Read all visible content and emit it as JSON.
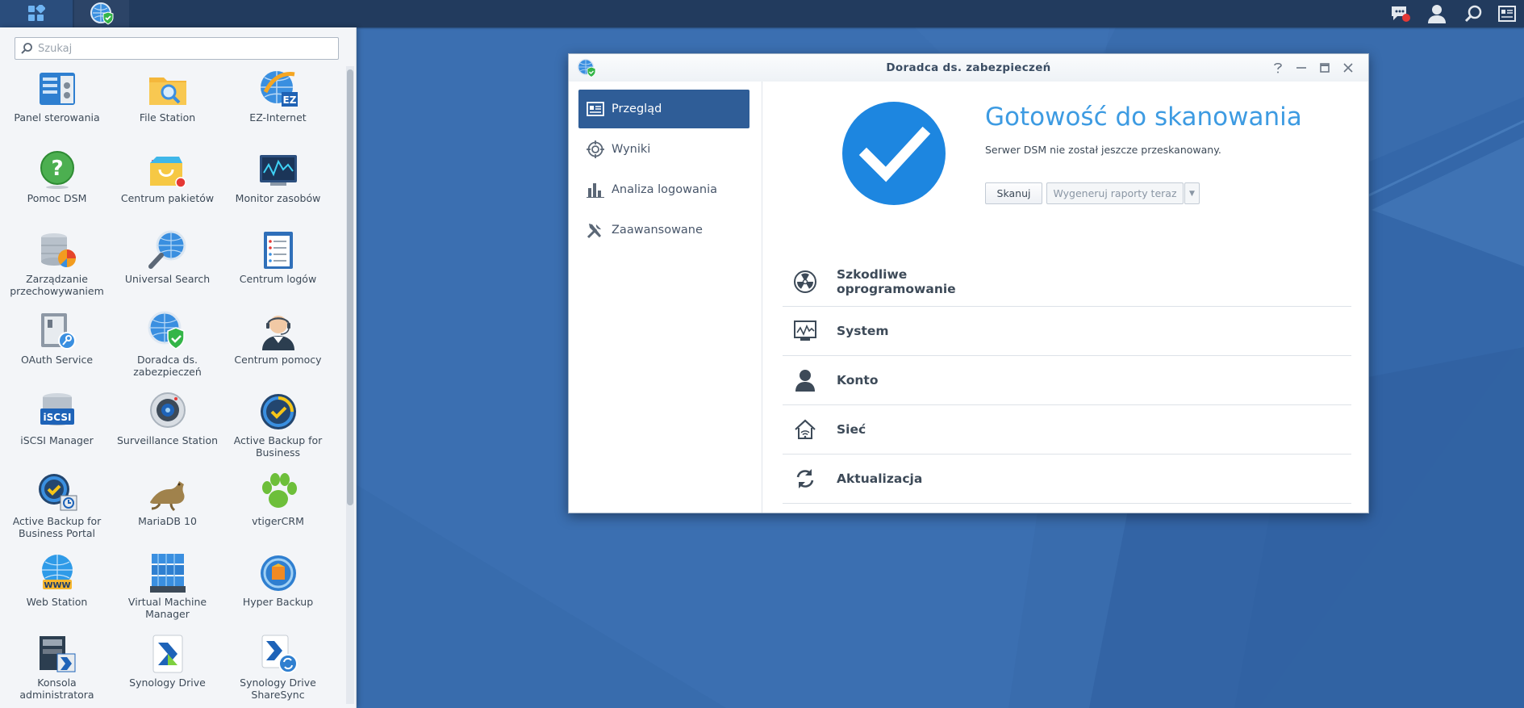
{
  "taskbar": {
    "main_menu_icon": "grid-icon",
    "active_app_icon": "security-advisor-icon",
    "right_icons": [
      "notification-icon",
      "user-icon",
      "search-icon",
      "widgets-icon"
    ]
  },
  "start_menu": {
    "search_placeholder": "Szukaj",
    "apps": [
      {
        "label": "Panel sterowania",
        "icon": "control-panel-icon"
      },
      {
        "label": "File Station",
        "icon": "file-station-icon"
      },
      {
        "label": "EZ-Internet",
        "icon": "ez-internet-icon"
      },
      {
        "label": "Pomoc DSM",
        "icon": "help-icon"
      },
      {
        "label": "Centrum pakietów",
        "icon": "package-center-icon"
      },
      {
        "label": "Monitor zasobów",
        "icon": "resource-monitor-icon"
      },
      {
        "label": "Zarządzanie przechowywaniem",
        "icon": "storage-manager-icon"
      },
      {
        "label": "Universal Search",
        "icon": "universal-search-icon"
      },
      {
        "label": "Centrum logów",
        "icon": "log-center-icon"
      },
      {
        "label": "OAuth Service",
        "icon": "oauth-service-icon"
      },
      {
        "label": "Doradca ds. zabezpieczeń",
        "icon": "security-advisor-icon"
      },
      {
        "label": "Centrum pomocy",
        "icon": "support-center-icon"
      },
      {
        "label": "iSCSI Manager",
        "icon": "iscsi-manager-icon"
      },
      {
        "label": "Surveillance Station",
        "icon": "surveillance-station-icon"
      },
      {
        "label": "Active Backup for Business",
        "icon": "active-backup-icon"
      },
      {
        "label": "Active Backup for Business Portal",
        "icon": "active-backup-portal-icon"
      },
      {
        "label": "MariaDB 10",
        "icon": "mariadb-icon"
      },
      {
        "label": "vtigerCRM",
        "icon": "vtigercrm-icon"
      },
      {
        "label": "Web Station",
        "icon": "web-station-icon"
      },
      {
        "label": "Virtual Machine Manager",
        "icon": "virtual-machine-manager-icon"
      },
      {
        "label": "Hyper Backup",
        "icon": "hyper-backup-icon"
      },
      {
        "label": "Konsola administratora",
        "icon": "admin-console-icon"
      },
      {
        "label": "Synology Drive",
        "icon": "synology-drive-icon"
      },
      {
        "label": "Synology Drive ShareSync",
        "icon": "sharesync-icon"
      }
    ]
  },
  "window": {
    "title": "Doradca ds. zabezpieczeń",
    "controls": [
      "help-icon",
      "minimize-icon",
      "maximize-icon",
      "close-icon"
    ],
    "nav": [
      {
        "label": "Przegląd",
        "icon": "overview-icon",
        "active": true
      },
      {
        "label": "Wyniki",
        "icon": "results-icon",
        "active": false
      },
      {
        "label": "Analiza logowania",
        "icon": "bar-chart-icon",
        "active": false
      },
      {
        "label": "Zaawansowane",
        "icon": "tools-icon",
        "active": false
      }
    ],
    "status": {
      "headline": "Gotowość do skanowania",
      "description": "Serwer DSM nie został jeszcze przeskanowany.",
      "scan_button": "Skanuj",
      "report_button": "Wygeneruj raporty teraz",
      "report_enabled": false
    },
    "categories": [
      {
        "label": "Szkodliwe oprogramowanie",
        "icon": "radiation-icon"
      },
      {
        "label": "System",
        "icon": "system-monitor-icon"
      },
      {
        "label": "Konto",
        "icon": "account-icon"
      },
      {
        "label": "Sieć",
        "icon": "network-home-icon"
      },
      {
        "label": "Aktualizacja",
        "icon": "refresh-icon"
      }
    ],
    "accent_color": "#1d86e0",
    "nav_active_color": "#2f5d97"
  }
}
